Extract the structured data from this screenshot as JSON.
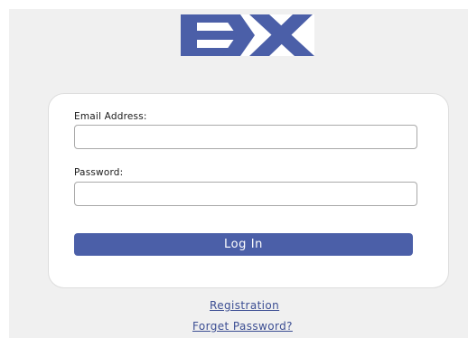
{
  "logo": {
    "text": "EX",
    "colors": {
      "primary": "#4b5fa8",
      "background": "#ffffff"
    }
  },
  "form": {
    "email_label": "Email Address:",
    "email_value": "",
    "password_label": "Password:",
    "password_value": "",
    "submit_label": "Log In"
  },
  "links": {
    "registration": "Registration",
    "forget_password": "Forget Password?"
  },
  "colors": {
    "accent": "#4b5fa8",
    "link": "#3c4e93",
    "page_background": "#f0f0f0",
    "card_background": "#ffffff"
  }
}
